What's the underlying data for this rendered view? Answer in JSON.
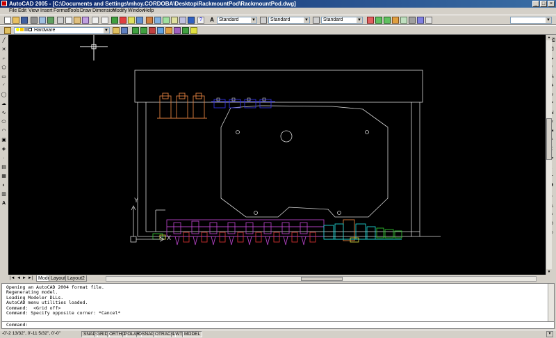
{
  "window": {
    "title": "AutoCAD 2005 - [C:\\Documents and Settings\\mhoy.CORDOBA\\Desktop\\RackmountPod\\RackmountPod.dwg]",
    "controls": [
      "_",
      "□",
      "×"
    ]
  },
  "menu": [
    "File",
    "Edit",
    "View",
    "Insert",
    "Format",
    "Tools",
    "Draw",
    "Dimension",
    "Modify",
    "Window",
    "Help"
  ],
  "toolbar": {
    "text_style": "Standard",
    "dim_style": "Standard",
    "table_style": "Standard",
    "layer": "Hardware"
  },
  "canvas": {
    "ucs_y": "Y",
    "ucs_x": "X"
  },
  "tabs": [
    "Model",
    "Layout1",
    "Layout2"
  ],
  "command": {
    "history": [
      "Opening an AutoCAD 2004 format file.",
      "Regenerating model.",
      "Loading Modeler DLLs.",
      "AutoCAD menu utilities loaded.",
      "Command:  <Grid off>",
      "Command: Specify opposite corner: *Cancel*"
    ],
    "prompt": "Command:"
  },
  "status": {
    "coords": "-0'-2 13/32\", 0'-11 5/32\", 0'-0\"",
    "toggles": [
      "SNAP",
      "GRID",
      "ORTHO",
      "POLAR",
      "OSNAP",
      "OTRACK",
      "LWT",
      "MODEL"
    ]
  },
  "colors": {
    "title_bar": "#0a246a",
    "canvas_bg": "#000000",
    "geometry": "#d8d8d8",
    "orange": "#e08040",
    "blue": "#3030e0",
    "magenta": "#b040c0",
    "cyan": "#20d0d0",
    "green": "#30c030",
    "yellow": "#d0d040"
  }
}
